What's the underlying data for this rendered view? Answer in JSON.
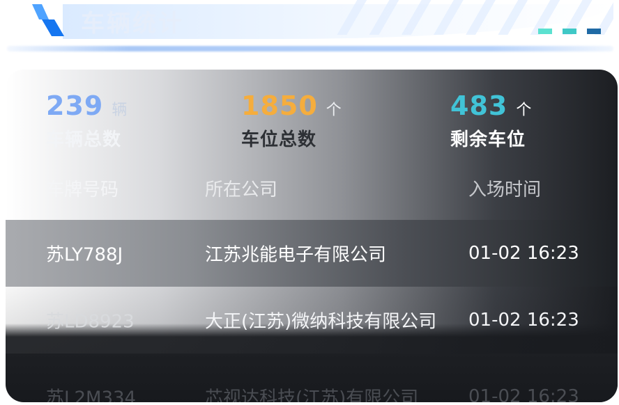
{
  "header": {
    "title": "车辆统计",
    "dash_colors": [
      "#5be1d0",
      "#3fc8c6",
      "#1f6aa5"
    ],
    "icon": "logo-parallelogram-icon"
  },
  "stats": [
    {
      "value": "239",
      "unit": "辆",
      "label": "车辆总数",
      "color": "#7ea9f4"
    },
    {
      "value": "1850",
      "unit": "个",
      "label": "车位总数",
      "color": "#f5ad3d"
    },
    {
      "value": "483",
      "unit": "个",
      "label": "剩余车位",
      "color": "#41c3d7"
    }
  ],
  "table": {
    "columns": [
      "车牌号码",
      "所在公司",
      "入场时间"
    ],
    "rows": [
      {
        "plate": "苏LY788J",
        "company": "江苏兆能电子有限公司",
        "time": "01-02 16:23"
      },
      {
        "plate": "苏LD8923",
        "company": "大正(江苏)微纳科技有限公司",
        "time": "01-02 16:23"
      },
      {
        "plate": "苏L2M334",
        "company": "芯视达科技(江苏)有限公司",
        "time": "01-02 16:23"
      }
    ]
  }
}
